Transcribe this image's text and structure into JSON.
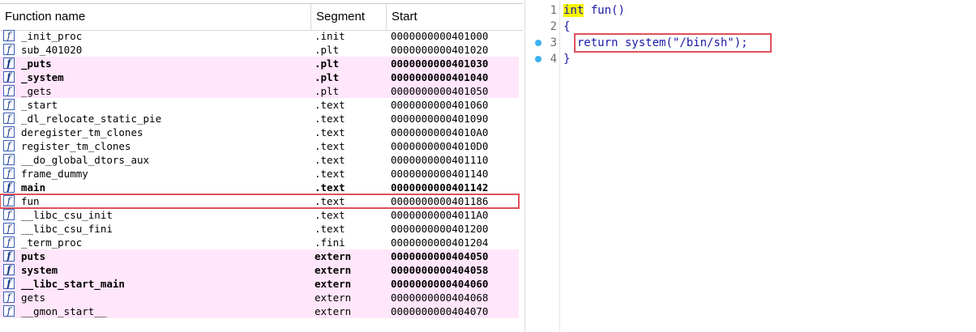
{
  "functions_window": {
    "columns": {
      "name": "Function name",
      "segment": "Segment",
      "start": "Start"
    },
    "rows": [
      {
        "name": "_init_proc",
        "segment": ".init",
        "start": "0000000000401000",
        "style": "normal"
      },
      {
        "name": "sub_401020",
        "segment": ".plt",
        "start": "0000000000401020",
        "style": "normal"
      },
      {
        "name": "_puts",
        "segment": ".plt",
        "start": "0000000000401030",
        "style": "pink-bold"
      },
      {
        "name": "_system",
        "segment": ".plt",
        "start": "0000000000401040",
        "style": "pink-bold"
      },
      {
        "name": "_gets",
        "segment": ".plt",
        "start": "0000000000401050",
        "style": "pink"
      },
      {
        "name": "_start",
        "segment": ".text",
        "start": "0000000000401060",
        "style": "normal"
      },
      {
        "name": "_dl_relocate_static_pie",
        "segment": ".text",
        "start": "0000000000401090",
        "style": "normal"
      },
      {
        "name": "deregister_tm_clones",
        "segment": ".text",
        "start": "00000000004010A0",
        "style": "normal"
      },
      {
        "name": "register_tm_clones",
        "segment": ".text",
        "start": "00000000004010D0",
        "style": "normal"
      },
      {
        "name": "__do_global_dtors_aux",
        "segment": ".text",
        "start": "0000000000401110",
        "style": "normal"
      },
      {
        "name": "frame_dummy",
        "segment": ".text",
        "start": "0000000000401140",
        "style": "normal"
      },
      {
        "name": "main",
        "segment": ".text",
        "start": "0000000000401142",
        "style": "bold"
      },
      {
        "name": "fun",
        "segment": ".text",
        "start": "0000000000401186",
        "style": "selected"
      },
      {
        "name": "__libc_csu_init",
        "segment": ".text",
        "start": "00000000004011A0",
        "style": "normal"
      },
      {
        "name": "__libc_csu_fini",
        "segment": ".text",
        "start": "0000000000401200",
        "style": "normal"
      },
      {
        "name": "_term_proc",
        "segment": ".fini",
        "start": "0000000000401204",
        "style": "normal"
      },
      {
        "name": "puts",
        "segment": "extern",
        "start": "0000000000404050",
        "style": "pink-bold"
      },
      {
        "name": "system",
        "segment": "extern",
        "start": "0000000000404058",
        "style": "pink-bold"
      },
      {
        "name": "__libc_start_main",
        "segment": "extern",
        "start": "0000000000404060",
        "style": "pink-bold"
      },
      {
        "name": "gets",
        "segment": "extern",
        "start": "0000000000404068",
        "style": "pink"
      },
      {
        "name": "__gmon_start__",
        "segment": "extern",
        "start": "0000000000404070",
        "style": "pink"
      }
    ],
    "icon": "function-icon"
  },
  "pseudocode": {
    "lines": [
      {
        "num": "1",
        "kw": "int",
        "rest": " fun()",
        "breakpoint": false
      },
      {
        "num": "2",
        "kw": "",
        "rest": "{",
        "breakpoint": false
      },
      {
        "num": "3",
        "kw": "",
        "rest": "  return system(\"/bin/sh\");",
        "breakpoint": true
      },
      {
        "num": "4",
        "kw": "",
        "rest": "}",
        "breakpoint": true
      }
    ]
  },
  "colors": {
    "pink_row": "#ffe6fa",
    "highlight_box": "#e0505a",
    "code_text": "#1a1aa6",
    "keyword_highlight": "#f7f700",
    "breakpoint_dot": "#3db0f0"
  }
}
